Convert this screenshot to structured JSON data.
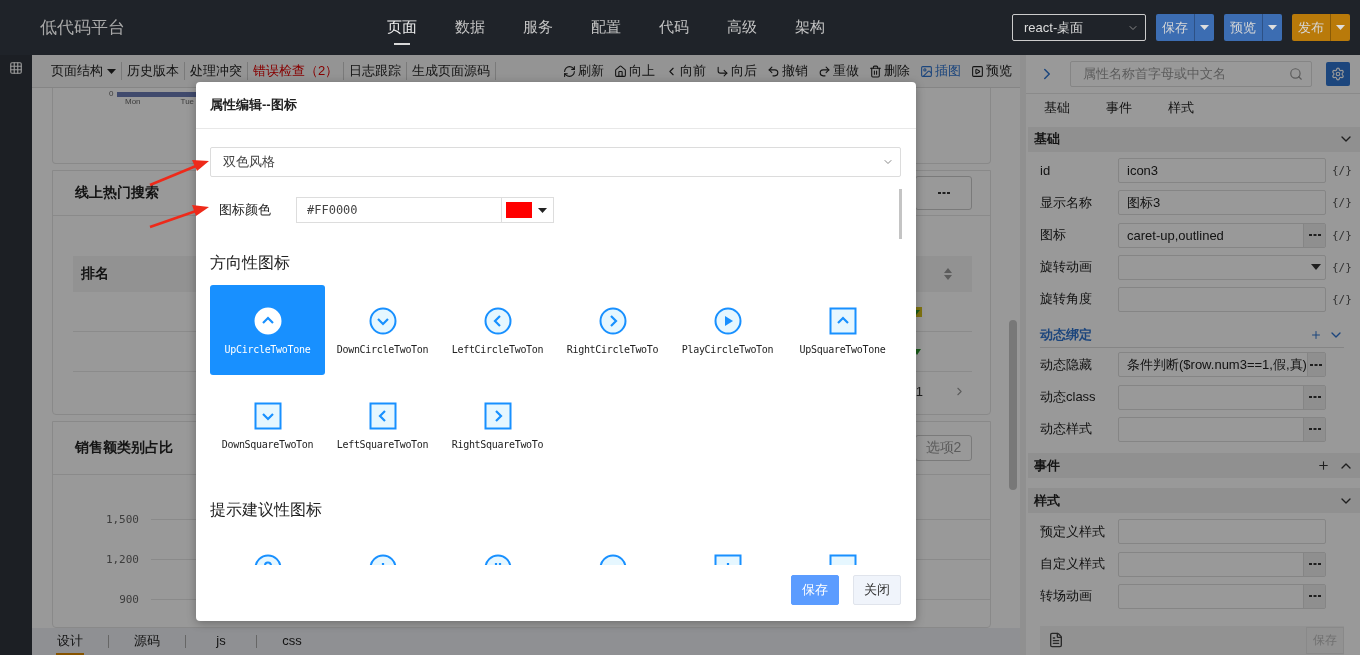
{
  "header": {
    "logo": "低代码平台",
    "nav": [
      {
        "label": "页面",
        "selected": true
      },
      {
        "label": "数据",
        "selected": false
      },
      {
        "label": "服务",
        "selected": false
      },
      {
        "label": "配置",
        "selected": false
      },
      {
        "label": "代码",
        "selected": false
      },
      {
        "label": "高级",
        "selected": false
      },
      {
        "label": "架构",
        "selected": false
      }
    ],
    "project_select": {
      "value": "react-桌面"
    },
    "actions": [
      {
        "label": "保存",
        "kind": "primary"
      },
      {
        "label": "预览",
        "kind": "primary"
      },
      {
        "label": "发布",
        "kind": "warning"
      }
    ]
  },
  "toolbar": {
    "left": [
      {
        "label": "页面结构",
        "dropdown": true,
        "alert": false
      },
      {
        "label": "历史版本",
        "dropdown": false,
        "alert": false
      },
      {
        "label": "处理冲突",
        "dropdown": false,
        "alert": false
      },
      {
        "label": "错误检查（2）",
        "dropdown": false,
        "alert": true
      },
      {
        "label": "日志跟踪",
        "dropdown": false,
        "alert": false
      },
      {
        "label": "生成页面源码",
        "dropdown": false,
        "alert": false
      }
    ],
    "right": [
      {
        "label": "刷新",
        "active": false
      },
      {
        "label": "向上",
        "active": false
      },
      {
        "label": "向前",
        "active": false
      },
      {
        "label": "向后",
        "active": false
      },
      {
        "label": "撤销",
        "active": false
      },
      {
        "label": "重做",
        "active": false
      },
      {
        "label": "删除",
        "active": false
      },
      {
        "label": "插图",
        "active": true
      },
      {
        "label": "预览",
        "active": false
      }
    ]
  },
  "canvas": {
    "top_chart": {
      "y_tick": "0",
      "x_labels": [
        "Mon",
        "Tue"
      ]
    },
    "search_card": {
      "title": "线上热门搜索",
      "column": "排名",
      "page": "1"
    },
    "sales_card": {
      "title": "销售额类别占比",
      "option": "选项2",
      "y_ticks": [
        "1,500",
        "1,200",
        "900"
      ]
    }
  },
  "bottom_tabs": [
    {
      "label": "设计",
      "selected": true
    },
    {
      "label": "源码",
      "selected": false
    },
    {
      "label": "js",
      "selected": false
    },
    {
      "label": "css",
      "selected": false
    }
  ],
  "inspector": {
    "search": {
      "placeholder": "属性名称首字母或中文名"
    },
    "tabs": [
      {
        "label": "基础"
      },
      {
        "label": "事件"
      },
      {
        "label": "样式"
      }
    ],
    "sections": [
      {
        "title": "基础",
        "expanded": true,
        "addable": false,
        "rows": [
          {
            "label": "id",
            "value": "icon3",
            "kind": "input",
            "binding": "{/}"
          },
          {
            "label": "显示名称",
            "value": "图标3",
            "kind": "input",
            "binding": "{/}"
          },
          {
            "label": "图标",
            "value": "caret-up,outlined",
            "kind": "picker",
            "binding": "{/}"
          },
          {
            "label": "旋转动画",
            "kind": "select",
            "binding": "{/}"
          },
          {
            "label": "旋转角度",
            "kind": "input",
            "binding": "{/}"
          }
        ],
        "sub": {
          "title": "动态绑定",
          "rows": [
            {
              "label": "动态隐藏",
              "value": "条件判断($row.num3==1,假,真)",
              "kind": "picker"
            },
            {
              "label": "动态class",
              "kind": "picker"
            },
            {
              "label": "动态样式",
              "kind": "picker"
            }
          ]
        }
      },
      {
        "title": "事件",
        "expanded": false,
        "addable": true
      },
      {
        "title": "样式",
        "expanded": true,
        "addable": false,
        "rows": [
          {
            "label": "预定义样式",
            "kind": "input"
          },
          {
            "label": "自定义样式",
            "kind": "picker"
          },
          {
            "label": "转场动画",
            "kind": "picker"
          }
        ]
      }
    ],
    "footer": {
      "save": "保存"
    }
  },
  "dialog": {
    "title": "属性编辑--图标",
    "style_select": {
      "value": "双色风格"
    },
    "color_field": {
      "label": "图标颜色",
      "value": "#FF0000"
    },
    "groups": [
      {
        "title": "方向性图标",
        "icons": [
          {
            "kind": "up-circle",
            "label": "UpCircleTwoTone",
            "selected": true
          },
          {
            "kind": "down-circle",
            "label": "DownCircleTwoTon",
            "selected": false
          },
          {
            "kind": "left-circle",
            "label": "LeftCircleTwoTon",
            "selected": false
          },
          {
            "kind": "right-circle",
            "label": "RightCircleTwoTo",
            "selected": false
          },
          {
            "kind": "play-circle",
            "label": "PlayCircleTwoTon",
            "selected": false
          },
          {
            "kind": "up-square",
            "label": "UpSquareTwoTone",
            "selected": false
          },
          {
            "kind": "down-square",
            "label": "DownSquareTwoTon",
            "selected": false
          },
          {
            "kind": "left-square",
            "label": "LeftSquareTwoTon",
            "selected": false
          },
          {
            "kind": "right-square",
            "label": "RightSquareTwoTo",
            "selected": false
          }
        ]
      },
      {
        "title": "提示建议性图标",
        "icons": [
          {
            "kind": "question-circle",
            "selected": false
          },
          {
            "kind": "plus-circle",
            "selected": false
          },
          {
            "kind": "pause-circle",
            "selected": false
          },
          {
            "kind": "minus-circle",
            "selected": false
          },
          {
            "kind": "plus-square",
            "selected": false
          },
          {
            "kind": "minus-square",
            "selected": false
          }
        ]
      }
    ],
    "buttons": [
      {
        "label": "保存",
        "kind": "primary"
      },
      {
        "label": "关闭",
        "kind": "default"
      }
    ]
  }
}
